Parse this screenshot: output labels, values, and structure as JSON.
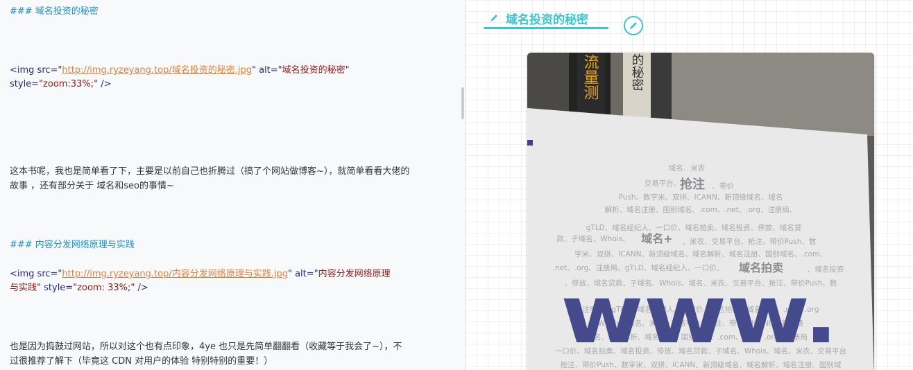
{
  "editor": {
    "lines": {
      "h1": "### 域名投资的秘密",
      "img1_open": "<img src=\"",
      "img1_url": "http://img.ryzeyang.top/域名投资的秘密.jpg",
      "img1_mid": "\" alt=\"",
      "img1_alt": "域名投资的秘密",
      "img1_close": "\"",
      "img1_style_attr": "style=",
      "img1_style_val": "\"zoom:33%;\"",
      "img1_end": " />",
      "para1_a": "这本书呢，我也是简单看了下，主要是以前自己也折腾过（搞了个网站做博客~），就简单看看大佬的",
      "para1_b": "故事 ，还有部分关于 域名和seo的事情~",
      "h2": "### 内容分发网络原理与实践",
      "img2_open": "<img src=\"",
      "img2_url": "http://img.ryzeyang.top/内容分发网络原理与实践.jpg",
      "img2_mid": "\" alt=\"",
      "img2_alt": "内容分发网络原理",
      "img2_alt_b": "与实践",
      "img2_style": "\" style=",
      "img2_style_val": "\"zoom: 33%;\"",
      "img2_end": " />",
      "para2_a": "也是因为捣鼓过网站，所以对这个也有点印象，4ye 也只是先简单翻翻看（收藏等于我会了~），不",
      "para2_b": "过很推荐了解下（毕竟这 CDN 对用户的体验 特别特别的重要！）"
    }
  },
  "preview": {
    "title": "域名投资的秘密",
    "image_alt": "域名投资的秘密",
    "accent_color": "#3ec3cf",
    "photo_text": {
      "top": "域名、米农",
      "t1": "交易平台、",
      "big1": "抢注",
      "t2": "、带价",
      "r1": "Push、数字米、双拼、ICANN、新顶级域名、域名",
      "r2": "解析、域名注册、国别域名、.com、.net、.org、注册局、",
      "r3": "gTLD、域名经纪人、一口价、域名拍卖、域名投资、停放、域名贷",
      "r4a": "款、子域名、Whois、",
      "big2": "域名+",
      "r4b": "、米农、交易平台、抢注、带价Push、数",
      "r5": "字米、双拼、ICANN、新顶级域名、域名解析、域名注册、国别域名、.com、",
      "r6a": ".net、.org、注册局、gTLD、域名经纪人、一口价、",
      "big3": "域名拍卖",
      "r6b": "、域名投资",
      "r7": "、停放、域名贷款、子域名、Whois、域名、米农、交易平台、抢注、带价Push、数",
      "r8": "注册局、gTLD、域名经纪人、一口价、域名拍卖、域名投资、.net、.org",
      "r9": "Whois、域名、米农、交易平台、抢注、带价、ICANN、新顶级",
      "r10": "名、域名解析、域名注册、国别域名、.com、.net、.org、注册局",
      "r11": "一口价、域名拍卖、域名投资、停放、域名贷款、子域名、Whois、域名、米农、交易平台",
      "r12": "抢注、带价Push、数字米、双拼、ICANN、新顶级域名、域名解析、域名注册、国别域",
      "www": "www.",
      "spine1": "流量测",
      "spine2": "网站的秘密"
    }
  }
}
